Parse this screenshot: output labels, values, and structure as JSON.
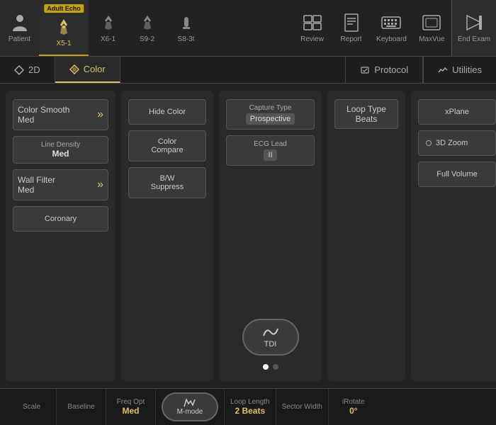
{
  "topBar": {
    "items": [
      {
        "id": "patient",
        "label": "Patient",
        "icon": "person"
      },
      {
        "id": "x51",
        "label": "X5-1",
        "icon": "probe",
        "badge": "Adult Echo",
        "active": true
      },
      {
        "id": "x61",
        "label": "X6-1",
        "icon": "probe2"
      },
      {
        "id": "s92",
        "label": "S9-2",
        "icon": "probe3"
      },
      {
        "id": "s83t",
        "label": "S8-3t",
        "icon": "probe4"
      },
      {
        "id": "spacer",
        "spacer": true
      },
      {
        "id": "review",
        "label": "Review",
        "icon": "grid"
      },
      {
        "id": "report",
        "label": "Report",
        "icon": "doc"
      },
      {
        "id": "keyboard",
        "label": "Keyboard",
        "icon": "keyboard"
      },
      {
        "id": "maxvue",
        "label": "MaxVue",
        "icon": "maxvue"
      },
      {
        "id": "endexam",
        "label": "End Exam",
        "icon": "folder"
      }
    ]
  },
  "tabs": {
    "items": [
      {
        "id": "2d",
        "label": "2D",
        "active": false
      },
      {
        "id": "color",
        "label": "Color",
        "active": true
      }
    ],
    "right": {
      "id": "protocol",
      "label": "Protocol"
    },
    "utilities": {
      "id": "utilities",
      "label": "Utilities"
    }
  },
  "panels": {
    "left": {
      "buttons": [
        {
          "id": "color-smooth",
          "title": "Color Smooth",
          "value": "Med",
          "hasArrow": true
        },
        {
          "id": "line-density",
          "title": "Line Density",
          "value": "Med",
          "hasArrow": false
        },
        {
          "id": "wall-filter",
          "title": "Wall Filter",
          "value": "Med",
          "hasArrow": true
        },
        {
          "id": "coronary",
          "title": "Coronary",
          "simple": true
        }
      ]
    },
    "midleft": {
      "buttons": [
        {
          "id": "hide-color",
          "label": "Hide Color"
        },
        {
          "id": "color-compare",
          "label": "Color\nCompare"
        },
        {
          "id": "bw-suppress",
          "label": "B/W\nSuppress"
        }
      ]
    },
    "center": {
      "captureType": {
        "title": "Capture Type",
        "value": "Prospective"
      },
      "ecgLead": {
        "title": "ECG Lead",
        "value": "II"
      },
      "tdi": {
        "label": "TDI"
      },
      "dots": [
        true,
        false
      ]
    },
    "centerRight": {
      "loopType": {
        "title": "Loop Type",
        "value": "Beats"
      }
    },
    "right": {
      "buttons": [
        {
          "id": "xplane",
          "label": "xPlane"
        },
        {
          "id": "3d-zoom",
          "label": "3D Zoom",
          "hasDot": true
        },
        {
          "id": "full-volume",
          "label": "Full Volume"
        }
      ]
    }
  },
  "bottomBar": {
    "items": [
      {
        "id": "scale",
        "label": "Scale",
        "value": "",
        "hasValue": false
      },
      {
        "id": "baseline",
        "label": "Baseline",
        "value": "",
        "hasValue": false
      },
      {
        "id": "freq-opt",
        "label": "Freq Opt",
        "value": "Med",
        "valueColor": "gold"
      },
      {
        "id": "m-mode",
        "label": "M-mode",
        "isButton": true
      },
      {
        "id": "loop-length",
        "label": "Loop Length",
        "value": "2 Beats",
        "valueColor": "gold"
      },
      {
        "id": "sector-width",
        "label": "Sector Width",
        "value": "",
        "hasValue": false
      },
      {
        "id": "irotate",
        "label": "iRotate",
        "value": "0°",
        "valueColor": "gold"
      }
    ]
  }
}
